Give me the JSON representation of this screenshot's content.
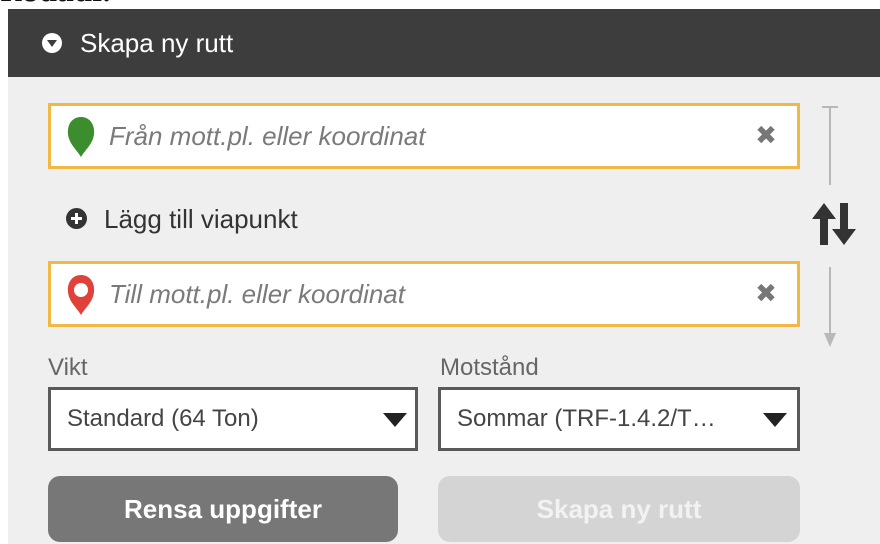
{
  "top_cut_text": "Rodadi.",
  "header": {
    "title": "Skapa ny rutt",
    "toggle_icon": "collapse-triangle-icon"
  },
  "route": {
    "from": {
      "placeholder": "Från mott.pl. eller koordinat",
      "value": "",
      "pin_icon": "green-map-pin-icon",
      "pin_color": "#3b8d2e"
    },
    "add_via_label": "Lägg till viapunkt",
    "to": {
      "placeholder": "Till mott.pl. eller koordinat",
      "value": "",
      "pin_icon": "red-map-pin-icon",
      "pin_color": "#e0413a"
    },
    "clear_icon": "✖",
    "swap_icon": "swap-arrows-icon"
  },
  "options": {
    "weight": {
      "label": "Vikt",
      "selected": "Standard (64 Ton)"
    },
    "resistance": {
      "label": "Motstånd",
      "selected": "Sommar (TRF-1.4.2/T…"
    }
  },
  "buttons": {
    "clear": "Rensa uppgifter",
    "create": "Skapa ny rutt",
    "create_disabled": true
  },
  "colors": {
    "header_bg": "#3d3d3d",
    "panel_bg": "#efefef",
    "input_border": "#f0b845",
    "btn_clear_bg": "#777777",
    "btn_create_bg": "#d4d4d4"
  }
}
